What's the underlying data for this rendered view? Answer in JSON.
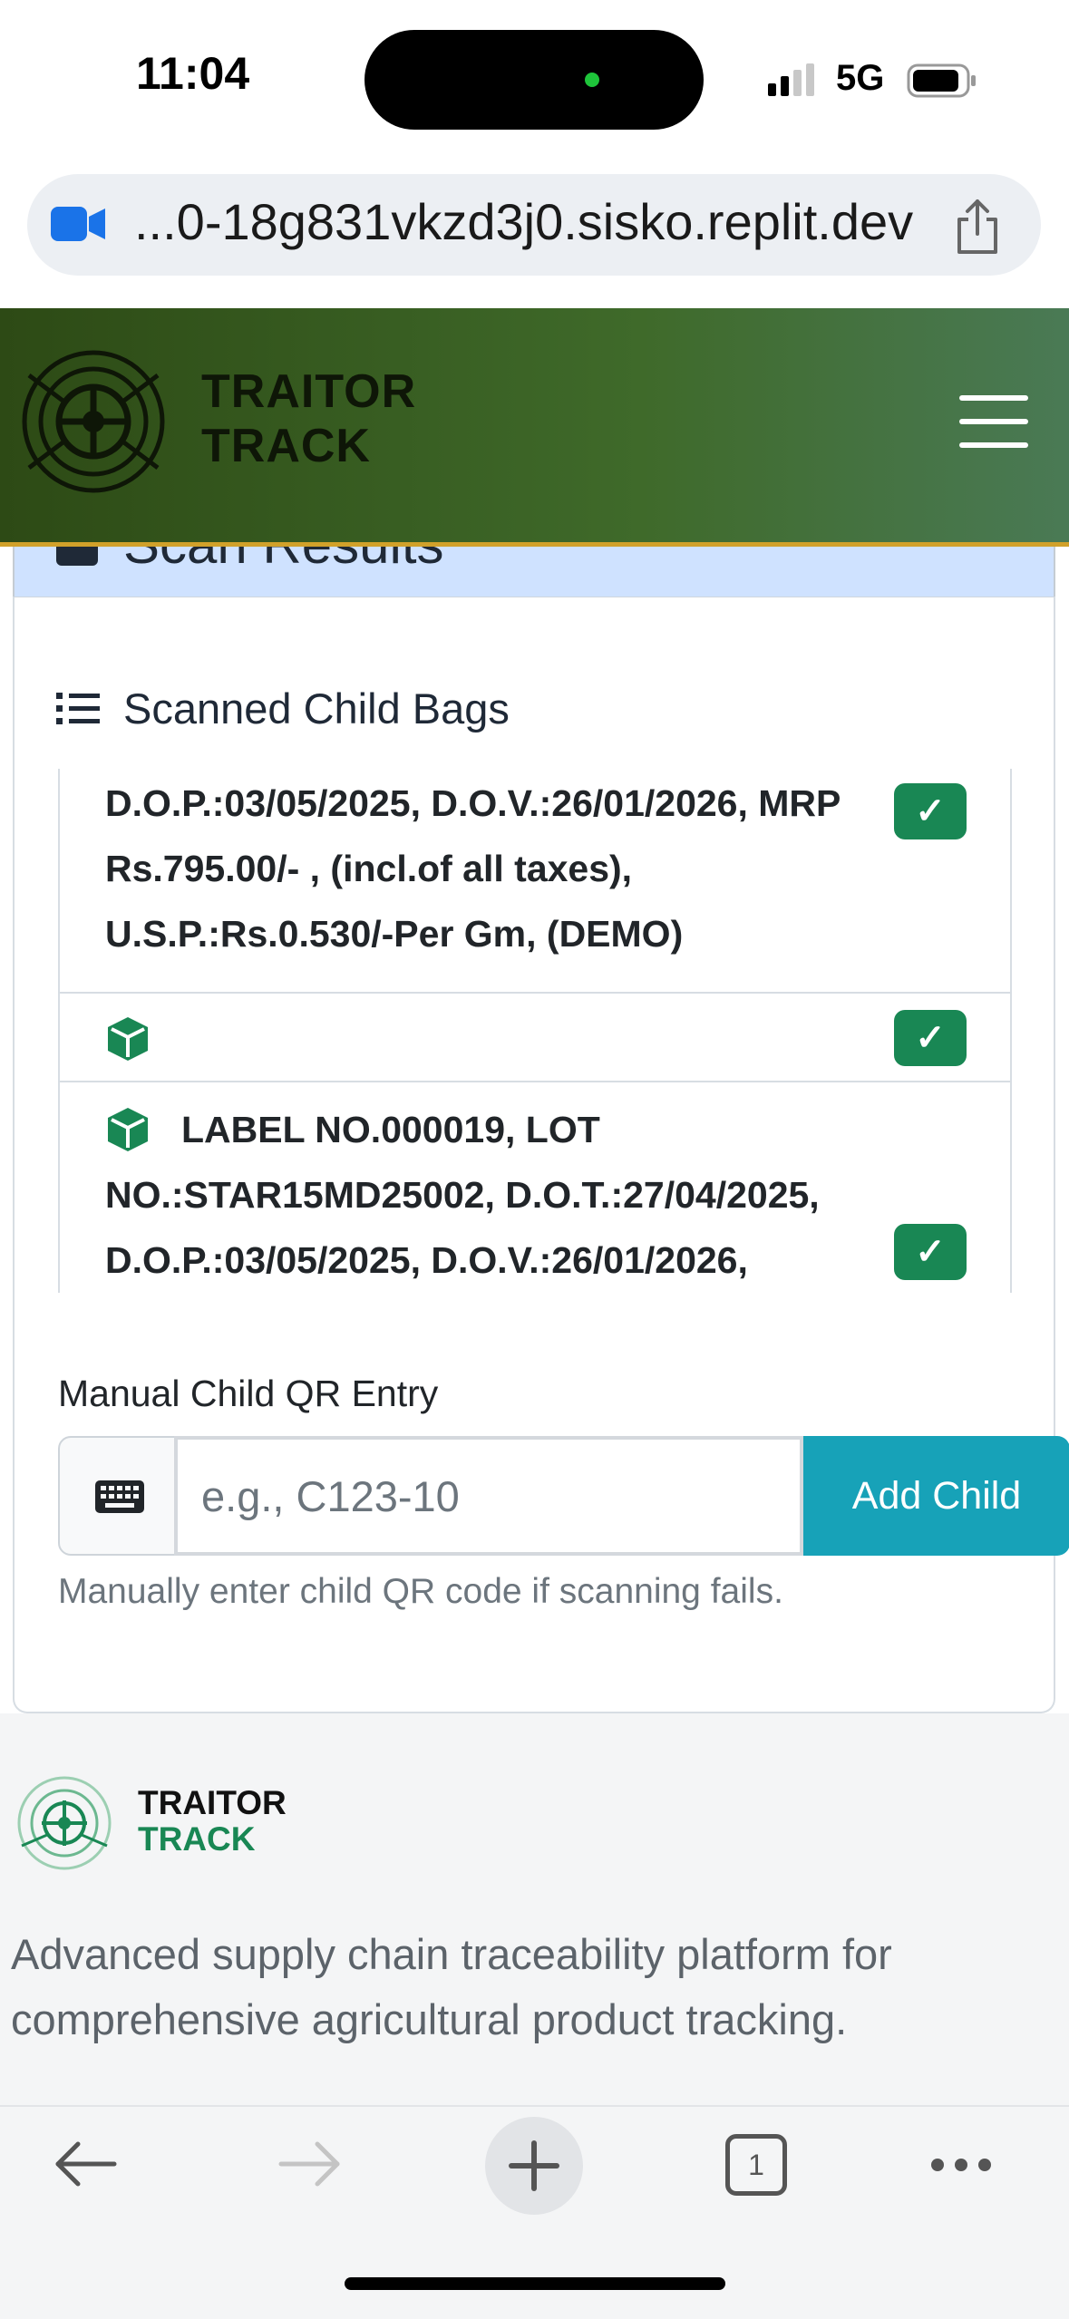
{
  "status_bar": {
    "time": "11:04",
    "network": "5G"
  },
  "browser": {
    "url": "...0-18g831vkzd3j0.sisko.replit.dev",
    "tab_count": "1"
  },
  "header": {
    "brand_line1": "TRAITOR",
    "brand_line2": "TRACK"
  },
  "card": {
    "title": "Scan Results",
    "section_title": "Scanned Child Bags",
    "items": [
      {
        "text": "D.O.P.:03/05/2025, D.O.V.:26/01/2026, MRP Rs.795.00/- , (incl.of all taxes), U.S.P.:Rs.0.530/-Per Gm, (DEMO)",
        "check": "✓"
      },
      {
        "text": "",
        "check": "✓"
      },
      {
        "text": "LABEL NO.000019, LOT NO.:STAR15MD25002, D.O.T.:27/04/2025, D.O.P.:03/05/2025, D.O.V.:26/01/2026,",
        "check": "✓"
      }
    ]
  },
  "manual_entry": {
    "label": "Manual Child QR Entry",
    "placeholder": "e.g., C123-10",
    "value": "",
    "button": "Add Child",
    "help": "Manually enter child QR code if scanning fails."
  },
  "footer": {
    "brand_line1": "TRAITOR",
    "brand_line2": "TRACK",
    "description": "Advanced supply chain traceability platform for comprehensive agricultural product tracking."
  },
  "colors": {
    "header_green": "#3f6a2a",
    "accent_gold": "#d1a12a",
    "success": "#198754",
    "info": "#17a2b8",
    "card_header": "#cfe2ff"
  },
  "icons": [
    "camera-icon",
    "share-icon",
    "logo-icon",
    "menu-icon",
    "check-square-icon",
    "list-icon",
    "box-icon",
    "checkmark-icon",
    "keyboard-icon",
    "back-arrow-icon",
    "forward-arrow-icon",
    "new-tab-icon",
    "tabs-icon",
    "more-icon"
  ]
}
